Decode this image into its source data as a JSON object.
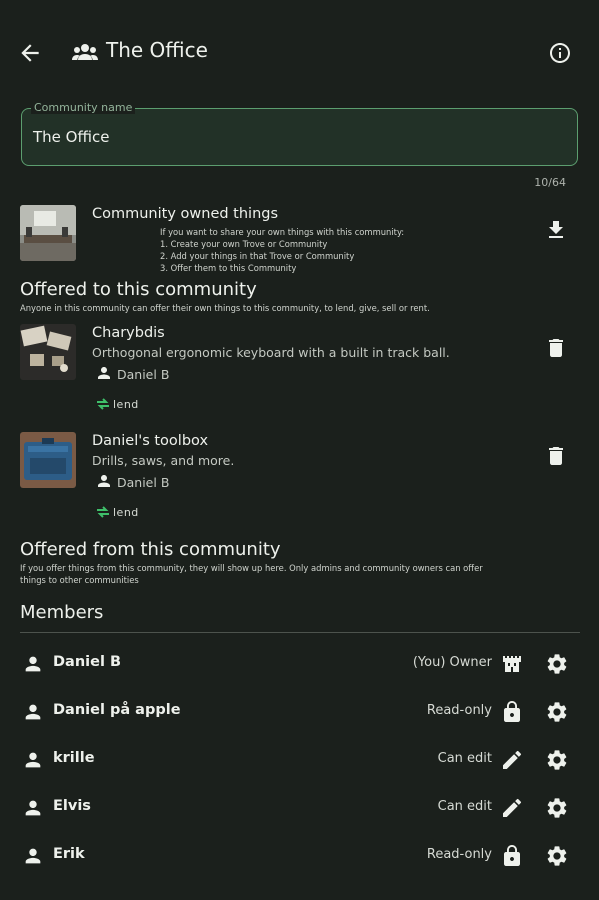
{
  "appbar": {
    "title": "The Office"
  },
  "field": {
    "label": "Community name",
    "value": "The Office",
    "counter": "10/64"
  },
  "owned": {
    "title": "Community owned things",
    "instructions": [
      "If you want to share your own things with this community:",
      "1. Create your own Trove or Community",
      "2. Add your things in that Trove or Community",
      "3. Offer them to this Community"
    ]
  },
  "offered_to": {
    "heading": "Offered to this community",
    "desc": "Anyone in this community can offer their own things to this community, to lend, give, sell or rent.",
    "items": [
      {
        "title": "Charybdis",
        "desc": "Orthogonal ergonomic keyboard with a built in track ball.",
        "owner": "Daniel B",
        "tag": "lend"
      },
      {
        "title": "Daniel's toolbox",
        "desc": "Drills, saws, and more.",
        "owner": "Daniel B",
        "tag": "lend"
      }
    ]
  },
  "offered_from": {
    "heading": "Offered from this community",
    "desc_line1": "If you offer things from this community, they will show up here. Only admins and community owners can offer",
    "desc_line2": "things to other communities"
  },
  "members": {
    "heading": "Members",
    "list": [
      {
        "name": "Daniel B",
        "role": "(You)  Owner",
        "icon": "castle-icon"
      },
      {
        "name": "Daniel på apple",
        "role": "Read-only",
        "icon": "lock-icon"
      },
      {
        "name": "krille",
        "role": "Can edit",
        "icon": "pencil-icon"
      },
      {
        "name": "Elvis",
        "role": "Can edit",
        "icon": "pencil-icon"
      },
      {
        "name": "Erik",
        "role": "Read-only",
        "icon": "lock-icon"
      }
    ]
  },
  "colors": {
    "background": "#1b201c",
    "field_border": "#5c9e6f",
    "lend_accent": "#3fbf6a"
  }
}
